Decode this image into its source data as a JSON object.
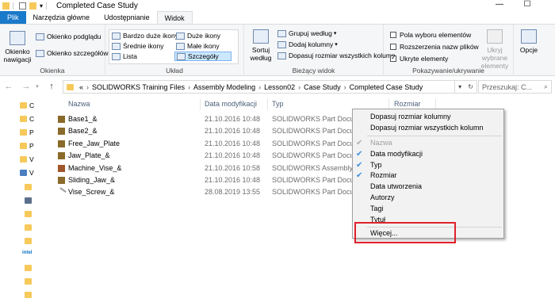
{
  "window": {
    "title": "Completed Case Study",
    "minimize": "—",
    "maximize": "☐"
  },
  "ribbon_tabs": [
    "Plik",
    "Narzędzia główne",
    "Udostępnianie",
    "Widok"
  ],
  "ribbon": {
    "panes": {
      "label": "Okienka",
      "nav_pane": "Okienko\nnawigacji",
      "preview_pane": "Okienko podglądu",
      "details_pane": "Okienko szczegółów"
    },
    "layout": {
      "label": "Układ",
      "items": [
        "Bardzo duże ikony",
        "Duże ikony",
        "Średnie ikony",
        "Małe ikony",
        "Lista",
        "Szczegóły"
      ]
    },
    "current_view": {
      "label": "Bieżący widok",
      "sort": "Sortuj\nwedług",
      "group_by": "Grupuj według",
      "add_columns": "Dodaj kolumny",
      "fit_columns": "Dopasuj rozmiar wszystkich kolumn"
    },
    "show_hide": {
      "label": "Pokazywanie/ukrywanie",
      "item_checkboxes": "Pola wyboru elementów",
      "file_extensions": "Rozszerzenia nazw plików",
      "hidden_items": "Ukryte elementy",
      "hide_selected": "Ukryj wybrane\nelementy",
      "options": "Opcje"
    }
  },
  "address": {
    "breadcrumbs": [
      "«",
      "SOLIDWORKS Training Files",
      "Assembly Modeling",
      "Lesson02",
      "Case Study",
      "Completed Case Study"
    ],
    "search_placeholder": "Przeszukaj: C..."
  },
  "nav_pane": {
    "items": [
      "C",
      "C",
      "P",
      "P",
      "V",
      "V"
    ]
  },
  "columns": [
    "Nazwa",
    "Data modyfikacji",
    "Typ",
    "Rozmiar"
  ],
  "files": [
    {
      "name": "Base1_&",
      "date": "21.10.2016 10:48",
      "type": "SOLIDWORKS Part Document",
      "icon_color": "#8a6a2a"
    },
    {
      "name": "Base2_&",
      "date": "21.10.2016 10:48",
      "type": "SOLIDWORKS Part Document",
      "icon_color": "#8a6a2a"
    },
    {
      "name": "Free_Jaw_Plate",
      "date": "21.10.2016 10:48",
      "type": "SOLIDWORKS Part Document",
      "icon_color": "#8a6a2a"
    },
    {
      "name": "Jaw_Plate_&",
      "date": "21.10.2016 10:48",
      "type": "SOLIDWORKS Part Document",
      "icon_color": "#8a6a2a"
    },
    {
      "name": "Machine_Vise_&",
      "date": "21.10.2016 10:58",
      "type": "SOLIDWORKS Assembly Document",
      "icon_color": "#a0552a"
    },
    {
      "name": "Sliding_Jaw_&",
      "date": "21.10.2016 10:48",
      "type": "SOLIDWORKS Part Document",
      "icon_color": "#8a6a2a"
    },
    {
      "name": "Vise_Screw_&",
      "date": "28.08.2019 13:55",
      "type": "SOLIDWORKS Part Document",
      "icon_color": "#9a9a9a"
    }
  ],
  "context_menu": {
    "fit_column": "Dopasuj rozmiar kolumny",
    "fit_all_columns": "Dopasuj rozmiar wszystkich kolumn",
    "columns": [
      {
        "label": "Nazwa",
        "checked": true,
        "disabled": true
      },
      {
        "label": "Data modyfikacji",
        "checked": true,
        "disabled": false
      },
      {
        "label": "Typ",
        "checked": true,
        "disabled": false
      },
      {
        "label": "Rozmiar",
        "checked": true,
        "disabled": false
      },
      {
        "label": "Data utworzenia",
        "checked": false,
        "disabled": false
      },
      {
        "label": "Autorzy",
        "checked": false,
        "disabled": false
      },
      {
        "label": "Tagi",
        "checked": false,
        "disabled": false
      },
      {
        "label": "Tytuł",
        "checked": false,
        "disabled": false
      }
    ],
    "more": "Więcej..."
  },
  "colors": {
    "accent": "#1979ca",
    "check_blue": "#3b8de0",
    "highlight_red": "#e0202a"
  }
}
